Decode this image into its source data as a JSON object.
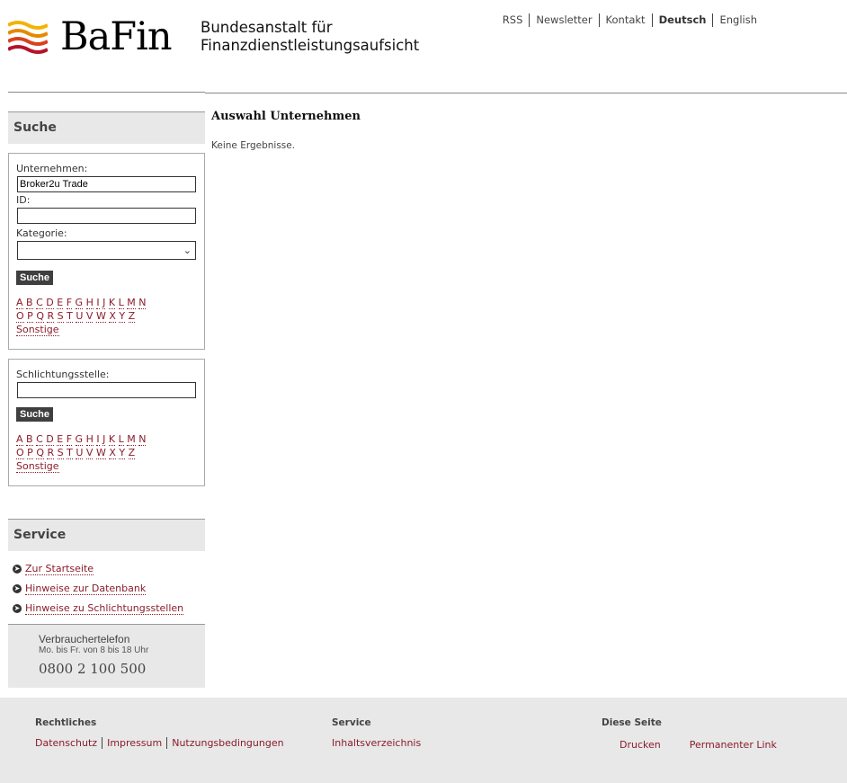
{
  "header": {
    "logo_word": "BaFin",
    "logo_sub_line1": "Bundesanstalt für",
    "logo_sub_line2": "Finanzdienstleistungsaufsicht",
    "topnav": [
      "RSS",
      "Newsletter",
      "Kontakt",
      "Deutsch",
      "English"
    ]
  },
  "search_section": {
    "title": "Suche",
    "company_label": "Unternehmen:",
    "company_value": "Broker2u Trade",
    "id_label": "ID:",
    "id_value": "",
    "category_label": "Kategorie:",
    "category_value": "",
    "button": "Suche",
    "alpha_row1": [
      "A",
      "B",
      "C",
      "D",
      "E",
      "F",
      "G",
      "H",
      "I",
      "J",
      "K",
      "L",
      "M",
      "N"
    ],
    "alpha_row2": [
      "O",
      "P",
      "Q",
      "R",
      "S",
      "T",
      "U",
      "V",
      "W",
      "X",
      "Y",
      "Z"
    ],
    "other": "Sonstige"
  },
  "arbitration_section": {
    "label": "Schlichtungsstelle:",
    "value": "",
    "button": "Suche",
    "alpha_row1": [
      "A",
      "B",
      "C",
      "D",
      "E",
      "F",
      "G",
      "H",
      "I",
      "J",
      "K",
      "L",
      "M",
      "N"
    ],
    "alpha_row2": [
      "O",
      "P",
      "Q",
      "R",
      "S",
      "T",
      "U",
      "V",
      "W",
      "X",
      "Y",
      "Z"
    ],
    "other": "Sonstige"
  },
  "service": {
    "title": "Service",
    "links": [
      "Zur Startseite",
      "Hinweise zur Datenbank",
      "Hinweise zu Schlichtungsstellen"
    ]
  },
  "phone": {
    "title": "Verbrauchertelefon",
    "hours": "Mo. bis Fr. von 8 bis 18 Uhr",
    "number": "0800 2 100 500"
  },
  "main": {
    "title": "Auswahl Unternehmen",
    "message": "Keine Ergebnisse."
  },
  "footer": {
    "legal_head": "Rechtliches",
    "legal_links": [
      "Datenschutz",
      "Impressum",
      "Nutzungsbedingungen"
    ],
    "service_head": "Service",
    "service_links": [
      "Inhaltsverzeichnis"
    ],
    "page_head": "Diese Seite",
    "page_links": [
      "Drucken",
      "Permanenter Link"
    ]
  },
  "colors": {
    "link": "#8a1c2b",
    "panel": "#e8e8e8",
    "button": "#3f3f3f"
  }
}
